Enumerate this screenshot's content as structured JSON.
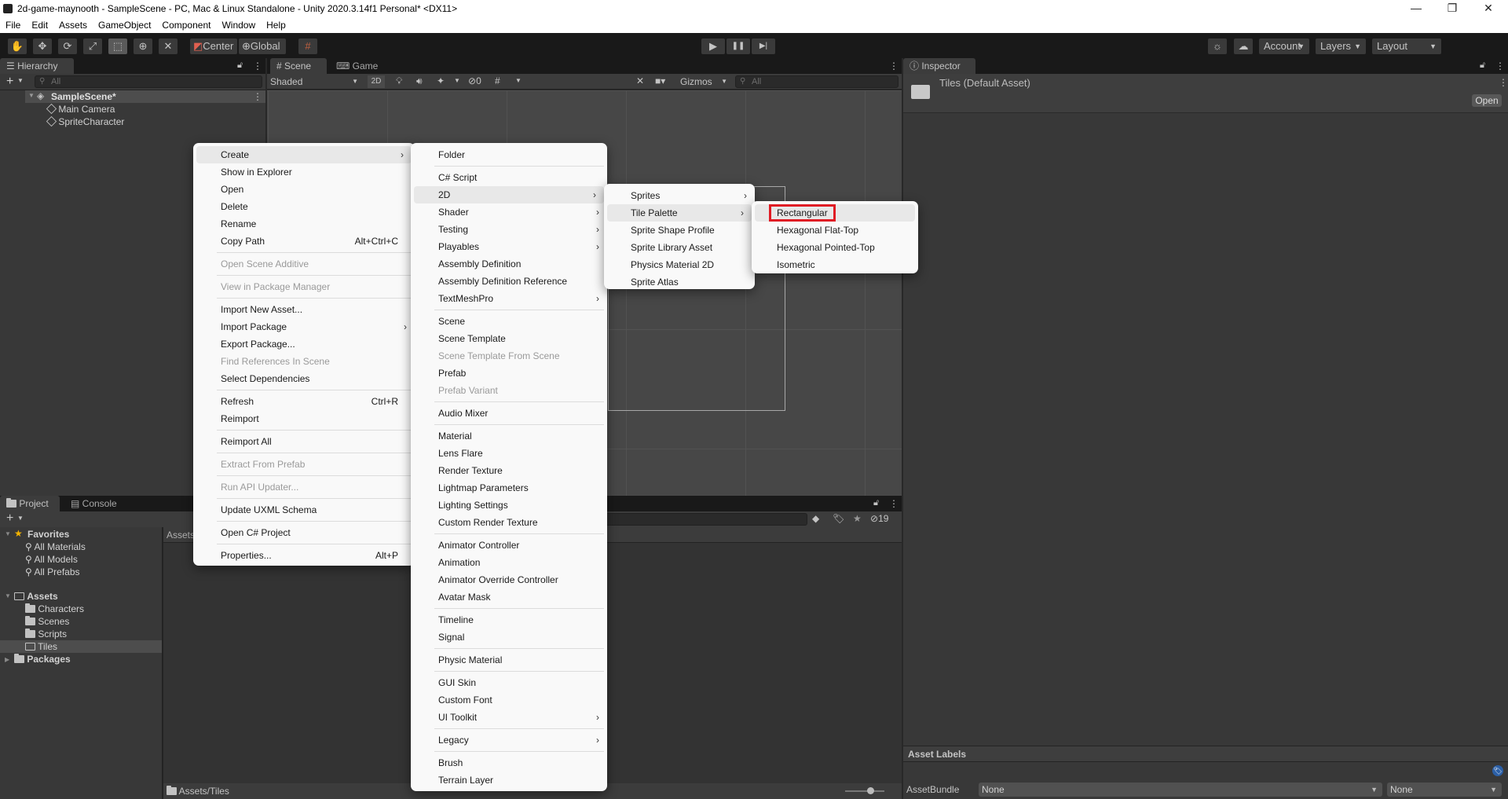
{
  "window": {
    "title": "2d-game-maynooth - SampleScene - PC, Mac & Linux Standalone - Unity 2020.3.14f1 Personal* <DX11>",
    "minimize": "—",
    "maximize": "❐",
    "close": "✕"
  },
  "menubar": [
    "File",
    "Edit",
    "Assets",
    "GameObject",
    "Component",
    "Window",
    "Help"
  ],
  "toolbar": {
    "tools": [
      {
        "name": "hand-tool",
        "glyph": "✋"
      },
      {
        "name": "move-tool",
        "glyph": "✥"
      },
      {
        "name": "rotate-tool",
        "glyph": "⟳"
      },
      {
        "name": "scale-tool",
        "glyph": "⤢"
      },
      {
        "name": "rect-tool",
        "glyph": "⬚"
      },
      {
        "name": "transform-tool",
        "glyph": "⊕"
      },
      {
        "name": "custom-tool",
        "glyph": "✕"
      }
    ],
    "pivot_label": "Center",
    "rotation_label": "Global",
    "snap_glyph": "#",
    "play_glyph": "▶",
    "pause_glyph": "❚❚",
    "step_glyph": "▶|",
    "account_label": "Account",
    "layers_label": "Layers",
    "layout_label": "Layout",
    "dropdown_arrow": "▼"
  },
  "hierarchy": {
    "tab_label": "Hierarchy",
    "search_placeholder": "All",
    "add_glyph": "+",
    "scene_name": "SampleScene*",
    "items": [
      "Main Camera",
      "SpriteCharacter"
    ]
  },
  "scene_view": {
    "tabs": [
      "Scene",
      "Game"
    ],
    "shading_mode": "Shaded",
    "mode_2d": "2D",
    "hidden_count": "0",
    "gizmos_label": "Gizmos",
    "search_placeholder": "All"
  },
  "inspector": {
    "tab_label": "Inspector",
    "asset_title": "Tiles (Default Asset)",
    "open_button": "Open",
    "asset_labels_header": "Asset Labels",
    "assetbundle_label": "AssetBundle",
    "assetbundle_value": "None",
    "assetbundle_variant": "None"
  },
  "project": {
    "tabs": [
      "Project",
      "Console"
    ],
    "favorites_label": "Favorites",
    "favorites": [
      "All Materials",
      "All Models",
      "All Prefabs"
    ],
    "assets_label": "Assets",
    "asset_folders": [
      "Characters",
      "Scenes",
      "Scripts",
      "Tiles"
    ],
    "packages_label": "Packages",
    "breadcrumb": "Assets",
    "hidden_packages_count": "19",
    "footer_path": "Assets/Tiles"
  },
  "context_menu": {
    "items": [
      {
        "label": "Create",
        "submenu": true,
        "highlighted": true
      },
      {
        "label": "Show in Explorer"
      },
      {
        "label": "Open"
      },
      {
        "label": "Delete"
      },
      {
        "label": "Rename"
      },
      {
        "label": "Copy Path",
        "shortcut": "Alt+Ctrl+C"
      },
      {
        "sep": true
      },
      {
        "label": "Open Scene Additive",
        "disabled": true
      },
      {
        "sep": true
      },
      {
        "label": "View in Package Manager",
        "disabled": true
      },
      {
        "sep": true
      },
      {
        "label": "Import New Asset..."
      },
      {
        "label": "Import Package",
        "submenu": true
      },
      {
        "label": "Export Package..."
      },
      {
        "label": "Find References In Scene",
        "disabled": true
      },
      {
        "label": "Select Dependencies"
      },
      {
        "sep": true
      },
      {
        "label": "Refresh",
        "shortcut": "Ctrl+R"
      },
      {
        "label": "Reimport"
      },
      {
        "sep": true
      },
      {
        "label": "Reimport All"
      },
      {
        "sep": true
      },
      {
        "label": "Extract From Prefab",
        "disabled": true
      },
      {
        "sep": true
      },
      {
        "label": "Run API Updater...",
        "disabled": true
      },
      {
        "sep": true
      },
      {
        "label": "Update UXML Schema"
      },
      {
        "sep": true
      },
      {
        "label": "Open C# Project"
      },
      {
        "sep": true
      },
      {
        "label": "Properties...",
        "shortcut": "Alt+P"
      }
    ]
  },
  "create_menu": {
    "items": [
      {
        "label": "Folder"
      },
      {
        "sep": true
      },
      {
        "label": "C# Script"
      },
      {
        "label": "2D",
        "submenu": true,
        "highlighted": true
      },
      {
        "label": "Shader",
        "submenu": true
      },
      {
        "label": "Testing",
        "submenu": true
      },
      {
        "label": "Playables",
        "submenu": true
      },
      {
        "label": "Assembly Definition"
      },
      {
        "label": "Assembly Definition Reference"
      },
      {
        "label": "TextMeshPro",
        "submenu": true
      },
      {
        "sep": true
      },
      {
        "label": "Scene"
      },
      {
        "label": "Scene Template"
      },
      {
        "label": "Scene Template From Scene",
        "disabled": true
      },
      {
        "label": "Prefab"
      },
      {
        "label": "Prefab Variant",
        "disabled": true
      },
      {
        "sep": true
      },
      {
        "label": "Audio Mixer"
      },
      {
        "sep": true
      },
      {
        "label": "Material"
      },
      {
        "label": "Lens Flare"
      },
      {
        "label": "Render Texture"
      },
      {
        "label": "Lightmap Parameters"
      },
      {
        "label": "Lighting Settings"
      },
      {
        "label": "Custom Render Texture"
      },
      {
        "sep": true
      },
      {
        "label": "Animator Controller"
      },
      {
        "label": "Animation"
      },
      {
        "label": "Animator Override Controller"
      },
      {
        "label": "Avatar Mask"
      },
      {
        "sep": true
      },
      {
        "label": "Timeline"
      },
      {
        "label": "Signal"
      },
      {
        "sep": true
      },
      {
        "label": "Physic Material"
      },
      {
        "sep": true
      },
      {
        "label": "GUI Skin"
      },
      {
        "label": "Custom Font"
      },
      {
        "label": "UI Toolkit",
        "submenu": true
      },
      {
        "sep": true
      },
      {
        "label": "Legacy",
        "submenu": true
      },
      {
        "sep": true
      },
      {
        "label": "Brush"
      },
      {
        "label": "Terrain Layer"
      }
    ]
  },
  "menu_2d": {
    "items": [
      {
        "label": "Sprites",
        "submenu": true
      },
      {
        "label": "Tile Palette",
        "submenu": true,
        "highlighted": true
      },
      {
        "label": "Sprite Shape Profile"
      },
      {
        "label": "Sprite Library Asset"
      },
      {
        "label": "Physics Material 2D"
      },
      {
        "label": "Sprite Atlas"
      }
    ]
  },
  "menu_tile_palette": {
    "items": [
      {
        "label": "Rectangular",
        "highlighted": true,
        "annotated": true
      },
      {
        "label": "Hexagonal Flat-Top"
      },
      {
        "label": "Hexagonal Pointed-Top"
      },
      {
        "label": "Isometric"
      }
    ]
  },
  "colors": {
    "annotation_box": "#e01b24",
    "editor_bg": "#282828",
    "panel_bg": "#383838",
    "menu_bg": "#f9f9f9",
    "toolbar_bg": "#191919",
    "favorite_star": "#f4b400",
    "label_badge": "#2b5fa6"
  },
  "submenu_arrow": "›"
}
